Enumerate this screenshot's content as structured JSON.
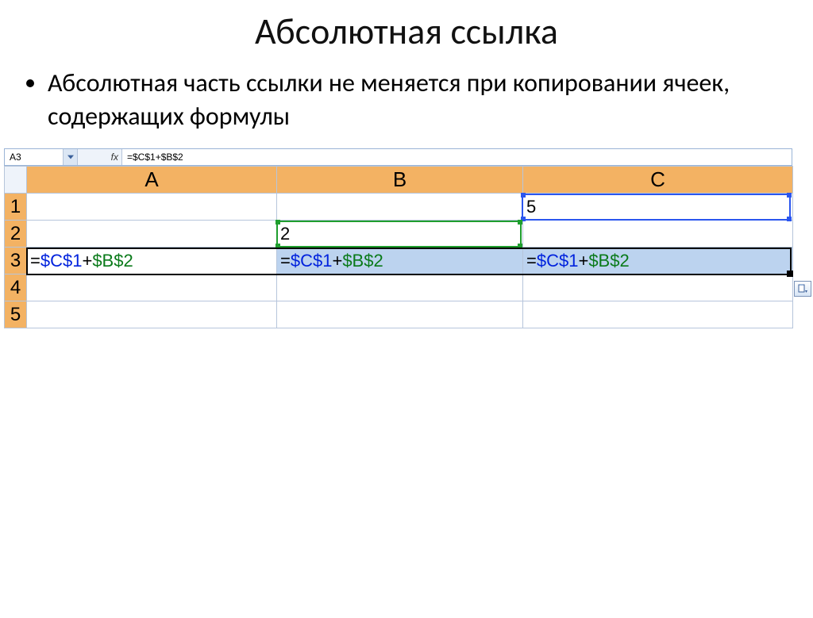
{
  "title": "Абсолютная ссылка",
  "bullet": "Абсолютная часть ссылки не меняется при копировании ячеек, содержащих формулы",
  "spreadsheet": {
    "name_box": "A3",
    "fx_label": "fx",
    "formula_bar": "=$C$1+$B$2",
    "columns": [
      "A",
      "B",
      "C"
    ],
    "rows": [
      "1",
      "2",
      "3",
      "4",
      "5"
    ],
    "C1": "5",
    "B2": "2",
    "formula_parts": {
      "eq": "=",
      "ref1": "$C$1",
      "plus": "+",
      "ref2": "$B$2"
    }
  }
}
